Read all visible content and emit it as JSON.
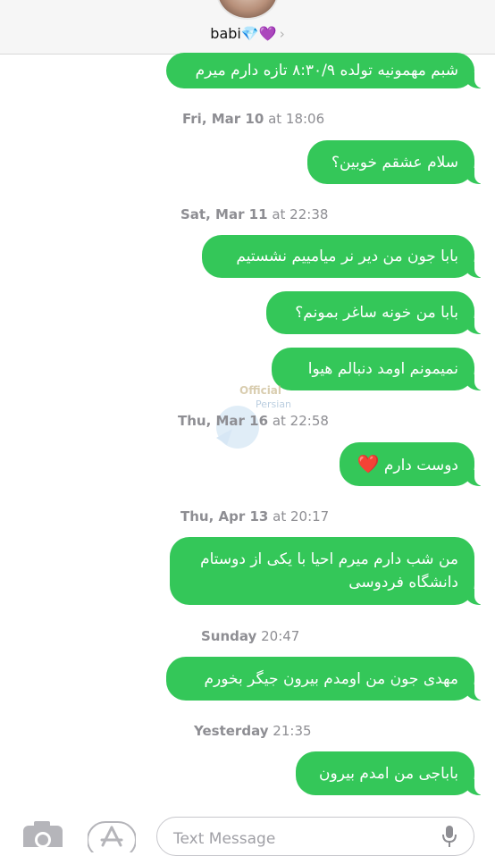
{
  "header": {
    "contact_name": "babi",
    "contact_emoji_1": "💎",
    "contact_emoji_2": "💜",
    "chevron": "›"
  },
  "messages": [
    {
      "type": "message",
      "text": "شبم مهمونیه تولده ۸:۳۰/۹ تازه دارم میرم"
    },
    {
      "type": "timestamp",
      "day": "Fri, Mar 10",
      "rest": "at 18:06"
    },
    {
      "type": "message",
      "text": "سلام عشقم خوبین؟"
    },
    {
      "type": "timestamp",
      "day": "Sat, Mar 11",
      "rest": "at 22:38"
    },
    {
      "type": "message",
      "text": "بابا جون من دیر نر میامییم نشستیم"
    },
    {
      "type": "message",
      "text": "بابا من خونه ساغر بمونم؟"
    },
    {
      "type": "message",
      "text": "نمیمونم اومد دنبالم هیوا"
    },
    {
      "type": "timestamp",
      "day": "Thu, Mar 16",
      "rest": "at 22:58"
    },
    {
      "type": "message",
      "text": "دوست دارم",
      "emoji": "❤️"
    },
    {
      "type": "timestamp",
      "day": "Thu, Apr 13",
      "rest": "at 20:17"
    },
    {
      "type": "message",
      "line1": "من شب دارم میرم احیا با یکی از دوستام",
      "line2": "دانشگاه فردوسی"
    },
    {
      "type": "timestamp",
      "day": "Sunday",
      "rest": "20:47"
    },
    {
      "type": "message",
      "text": "مهدی جون من اومدم بیرون  جیگر بخورم"
    },
    {
      "type": "timestamp",
      "day": "Yesterday",
      "rest": "21:35"
    },
    {
      "type": "message",
      "text": "باباجی من امدم بیرون"
    }
  ],
  "watermark": {
    "line1": "Official",
    "line2": "Persian"
  },
  "composer": {
    "placeholder": "Text Message"
  },
  "icons": [
    "back-icon",
    "camera-icon",
    "appstore-icon",
    "mic-icon"
  ],
  "colors": {
    "bubble": "#34c759",
    "timestamp": "#8e8e93"
  }
}
